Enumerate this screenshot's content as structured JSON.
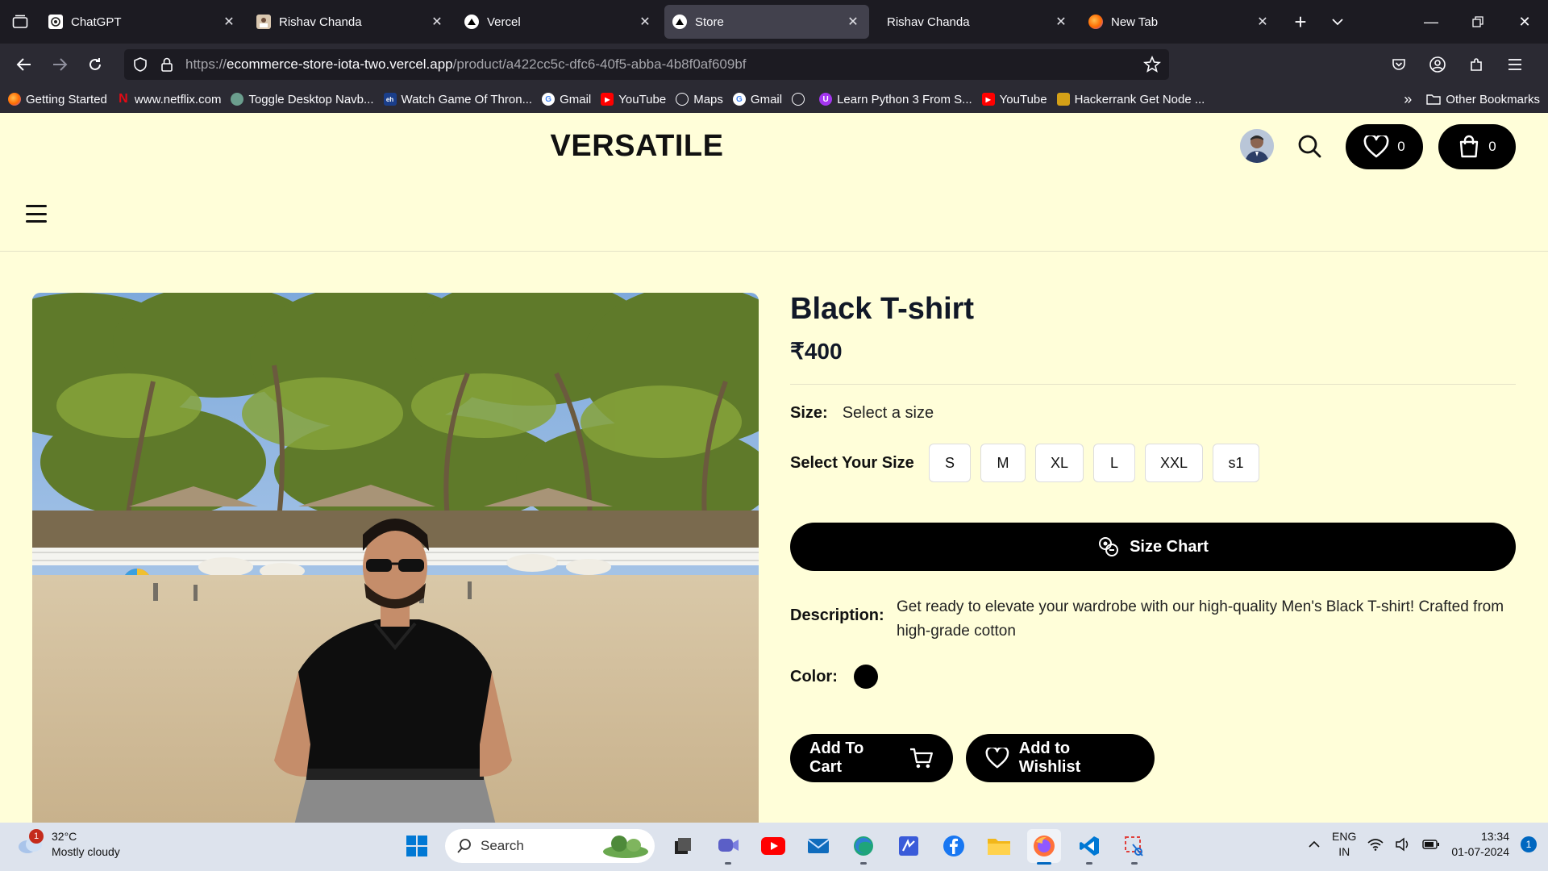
{
  "browser": {
    "tabs": [
      {
        "title": "ChatGPT",
        "icon": "chatgpt-icon",
        "active": false
      },
      {
        "title": "Rishav Chanda",
        "icon": "profile-photo-icon",
        "active": false
      },
      {
        "title": "Vercel",
        "icon": "vercel-icon",
        "active": false
      },
      {
        "title": "Store",
        "icon": "vercel-icon",
        "active": true
      },
      {
        "title": "Rishav Chanda",
        "icon": "none",
        "active": false
      },
      {
        "title": "New Tab",
        "icon": "firefox-icon",
        "active": false
      }
    ],
    "url_prefix": "https://",
    "url_host": "ecommerce-store-iota-two.vercel.app",
    "url_path": "/product/a422cc5c-dfc6-40f5-abba-4b8f0af609bf",
    "bookmarks": [
      {
        "label": "Getting Started",
        "icon": "firefox-icon",
        "color": "#e66000"
      },
      {
        "label": "www.netflix.com",
        "icon": "netflix-icon",
        "color": "#e50914"
      },
      {
        "label": "Toggle Desktop Navb...",
        "icon": "chatgpt-icon",
        "color": "#6b9e8e"
      },
      {
        "label": "Watch Game Of Thron...",
        "icon": "site-icon",
        "color": "#1a3e8a"
      },
      {
        "label": "Gmail",
        "icon": "google-icon",
        "color": "#4285f4"
      },
      {
        "label": "YouTube",
        "icon": "youtube-icon",
        "color": "#ff0000"
      },
      {
        "label": "Maps",
        "icon": "globe-icon",
        "color": "#2b2a33"
      },
      {
        "label": "Gmail",
        "icon": "google-icon",
        "color": "#4285f4"
      },
      {
        "label": "",
        "icon": "globe-icon",
        "color": "#2b2a33"
      },
      {
        "label": "Learn Python 3 From S...",
        "icon": "udemy-icon",
        "color": "#a435f0"
      },
      {
        "label": "YouTube",
        "icon": "youtube-icon",
        "color": "#ff0000"
      },
      {
        "label": "Hackerrank Get Node ...",
        "icon": "hackerrank-icon",
        "color": "#d4a017"
      }
    ],
    "other_bookmarks": "Other Bookmarks"
  },
  "store": {
    "brand": "VERSATILE",
    "wishlist_count": "0",
    "cart_count": "0"
  },
  "product": {
    "title": "Black T-shirt",
    "price": "₹400",
    "size_label": "Size:",
    "size_value": "Select a size",
    "select_size_label": "Select Your Size",
    "sizes": [
      "S",
      "M",
      "XL",
      "L",
      "XXL",
      "s1"
    ],
    "size_chart_label": "Size Chart",
    "description_label": "Description:",
    "description": "Get ready to elevate your wardrobe with our high-quality Men's Black T-shirt! Crafted from high-grade cotton",
    "color_label": "Color:",
    "color_value": "#000000",
    "add_to_cart_label": "Add To Cart",
    "add_to_wishlist_label": "Add to Wishlist"
  },
  "taskbar": {
    "weather_temp": "32°C",
    "weather_desc": "Mostly cloudy",
    "weather_badge": "1",
    "search_placeholder": "Search",
    "lang_top": "ENG",
    "lang_bottom": "IN",
    "time": "13:34",
    "date": "01-07-2024",
    "notification_count": "1"
  }
}
